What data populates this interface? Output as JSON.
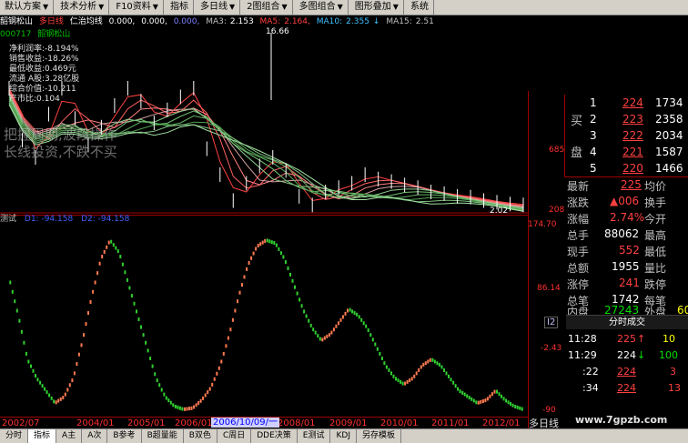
{
  "toolbar": {
    "items": [
      "默认方案",
      "技术分析",
      "F10资料",
      "指标",
      "多日线",
      "2图组合",
      "多图组合",
      "图形叠加",
      "系统"
    ]
  },
  "infobar": {
    "stock_name": "韶钢松山",
    "period": "多日线",
    "indicator": "仁治均线",
    "zero1": "0.000,",
    "zero2": "0.000,",
    "zero3": "0.000,",
    "ma3_label": "MA3:",
    "ma3": "2.153",
    "ma5_label": "MA5:",
    "ma5": "2.164,",
    "ma10_label": "MA10:",
    "ma10": "2.355",
    "ma15_label": "MA15:",
    "ma15": "2.51"
  },
  "codebar": {
    "code": "000717",
    "name": "韶钢松山"
  },
  "fundamentals": [
    "净利润率:-8.194%",
    "销售收益:-18.26%",
    "最低收益:0.469元",
    "流通 A股:3.28亿股",
    "综合价值:-10.211",
    "产市比:0.104"
  ],
  "watermark": {
    "line1": "把握周期,波段操作",
    "line2": "长线投资,不跌不买"
  },
  "main_chart": {
    "high_label": "16.66",
    "low_label": "2.02",
    "y_labels": [
      "685",
      "208"
    ]
  },
  "sub_chart": {
    "name": "测试",
    "val1": "D1: -94.158",
    "val2": "D2: -94.158",
    "y_labels": [
      "174.70",
      "86.14",
      "-2.43",
      "-90"
    ]
  },
  "timeline": {
    "labels": [
      "2002/07",
      "2004/01",
      "2005/01",
      "2006/01",
      "2008/01",
      "2009/01",
      "2010/01",
      "2011/01",
      "2012/01"
    ],
    "cursor_date": "2006/10/09/一",
    "right_label": "多日线"
  },
  "tabs": {
    "items": [
      "分时",
      "指标",
      "A主",
      "A次",
      "B参考",
      "B超量能",
      "B双色",
      "C周日",
      "DDE决策",
      "E测试",
      "KDJ",
      "另存模板"
    ],
    "active": "指标"
  },
  "order_book": {
    "side_label_1": "买",
    "side_label_2": "盘",
    "rows": [
      {
        "level": "1",
        "price": "224",
        "vol": "1734"
      },
      {
        "level": "2",
        "price": "223",
        "vol": "2358"
      },
      {
        "level": "3",
        "price": "222",
        "vol": "2034"
      },
      {
        "level": "4",
        "price": "221",
        "vol": "1587"
      },
      {
        "level": "5",
        "price": "220",
        "vol": "1466"
      }
    ]
  },
  "quote": {
    "rows": [
      {
        "l1": "最新",
        "v1": "225",
        "c1": "red",
        "l2": "均价",
        "v2": ""
      },
      {
        "l1": "涨跌",
        "v1": "▲006",
        "c1": "red",
        "l2": "换手",
        "v2": ""
      },
      {
        "l1": "涨幅",
        "v1": "2.74%",
        "c1": "red",
        "l2": "今开",
        "v2": ""
      },
      {
        "l1": "总手",
        "v1": "88062",
        "c1": "white",
        "l2": "最高",
        "v2": ""
      },
      {
        "l1": "现手",
        "v1": "552",
        "c1": "red",
        "l2": "最低",
        "v2": ""
      },
      {
        "l1": "总额",
        "v1": "1955",
        "c1": "white",
        "l2": "量比",
        "v2": ""
      },
      {
        "l1": "涨停",
        "v1": "241",
        "c1": "red",
        "l2": "跌停",
        "v2": ""
      },
      {
        "l1": "总笔",
        "v1": "1742",
        "c1": "white",
        "l2": "每笔",
        "v2": ""
      },
      {
        "l1": "内盘",
        "v1": "27243",
        "c1": "green",
        "l2": "外盘",
        "v2": "60"
      }
    ]
  },
  "trades": {
    "header": "分时成交",
    "marker": "I2",
    "rows": [
      {
        "time": "11:28",
        "price": "225",
        "dir": "↑",
        "vol": "10",
        "pc": "red",
        "vc": "yellow"
      },
      {
        "time": "11:29",
        "price": "224",
        "dir": "↓",
        "vol": "100",
        "pc": "white",
        "vc": "green"
      },
      {
        "time": ":22",
        "price": "224",
        "dir": "",
        "vol": "3",
        "pc": "red",
        "vc": "red"
      },
      {
        "time": ":34",
        "price": "224",
        "dir": "",
        "vol": "13",
        "pc": "red",
        "vc": "red"
      }
    ]
  },
  "website": "www.7gpzb.com",
  "chart_data": {
    "type": "line",
    "title": "",
    "series": [
      {
        "name": "",
        "values": [
          120,
          60,
          -10,
          -40,
          -60,
          -80,
          -70,
          -40,
          20,
          90,
          150,
          180,
          160,
          110,
          60,
          10,
          -40,
          -70,
          -85,
          -90,
          -88,
          -75,
          -55,
          -20,
          30,
          90,
          140,
          170,
          180,
          175,
          150,
          110,
          70,
          40,
          20,
          30,
          50,
          70,
          60,
          40,
          10,
          -20,
          -40,
          -50,
          -40,
          -20,
          -10,
          -20,
          -40,
          -60,
          -70,
          -80,
          -75,
          -60,
          -75,
          -85,
          -90
        ]
      }
    ],
    "ylim": [
      -90,
      180
    ]
  }
}
